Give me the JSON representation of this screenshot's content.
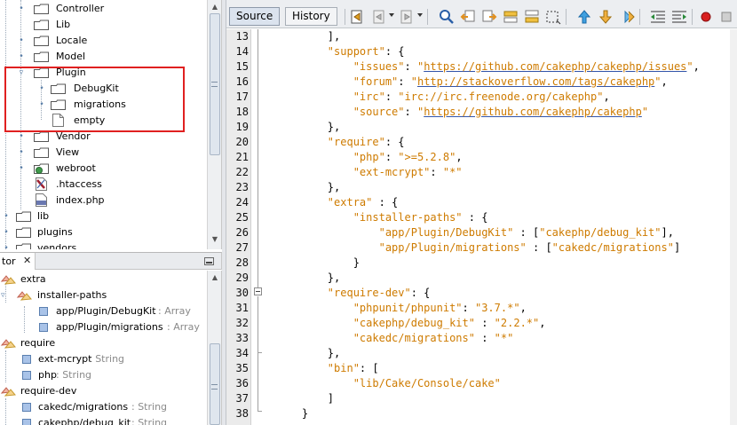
{
  "project_tree": {
    "items": [
      {
        "label": "Controller"
      },
      {
        "label": "Lib"
      },
      {
        "label": "Locale"
      },
      {
        "label": "Model"
      },
      {
        "label": "Plugin"
      },
      {
        "label": "DebugKit"
      },
      {
        "label": "migrations"
      },
      {
        "label": "empty"
      },
      {
        "label": "Vendor"
      },
      {
        "label": "View"
      },
      {
        "label": "webroot"
      },
      {
        "label": ".htaccess"
      },
      {
        "label": "index.php"
      },
      {
        "label": "lib"
      },
      {
        "label": "plugins"
      },
      {
        "label": "vendors"
      }
    ]
  },
  "navigator": {
    "tab_label": "tor",
    "close_glyph": "✕",
    "items": [
      {
        "label": "extra",
        "type": ""
      },
      {
        "label": "installer-paths",
        "type": ""
      },
      {
        "label": "app/Plugin/DebugKit",
        "type": " : Array"
      },
      {
        "label": "app/Plugin/migrations",
        "type": " : Array"
      },
      {
        "label": "require",
        "type": ""
      },
      {
        "label": "ext-mcrypt",
        "type": " : String"
      },
      {
        "label": "php",
        "type": " : String"
      },
      {
        "label": "require-dev",
        "type": ""
      },
      {
        "label": "cakedc/migrations",
        "type": " : String"
      },
      {
        "label": "cakephp/debug_kit",
        "type": " : String"
      }
    ]
  },
  "editor": {
    "tabs": {
      "source": "Source",
      "history": "History"
    },
    "colors": {
      "string": "#ce7b00",
      "link_underline": "#3355aa",
      "gutter": "#ebebeb"
    },
    "lines": [
      {
        "n": "13",
        "c": "        ],"
      },
      {
        "n": "14",
        "c": "        \"support\": {"
      },
      {
        "n": "15",
        "c": "            \"issues\": \"https://github.com/cakephp/cakephp/issues\","
      },
      {
        "n": "16",
        "c": "            \"forum\": \"http://stackoverflow.com/tags/cakephp\","
      },
      {
        "n": "17",
        "c": "            \"irc\": \"irc://irc.freenode.org/cakephp\","
      },
      {
        "n": "18",
        "c": "            \"source\": \"https://github.com/cakephp/cakephp\""
      },
      {
        "n": "19",
        "c": "        },"
      },
      {
        "n": "20",
        "c": "        \"require\": {"
      },
      {
        "n": "21",
        "c": "            \"php\": \">=5.2.8\","
      },
      {
        "n": "22",
        "c": "            \"ext-mcrypt\": \"*\""
      },
      {
        "n": "23",
        "c": "        },"
      },
      {
        "n": "24",
        "c": "        \"extra\" : {"
      },
      {
        "n": "25",
        "c": "            \"installer-paths\" : {"
      },
      {
        "n": "26",
        "c": "                \"app/Plugin/DebugKit\" : [\"cakephp/debug_kit\"],"
      },
      {
        "n": "27",
        "c": "                \"app/Plugin/migrations\" : [\"cakedc/migrations\"]"
      },
      {
        "n": "28",
        "c": "            }"
      },
      {
        "n": "29",
        "c": "        },"
      },
      {
        "n": "30",
        "c": "        \"require-dev\": {"
      },
      {
        "n": "31",
        "c": "            \"phpunit/phpunit\": \"3.7.*\","
      },
      {
        "n": "32",
        "c": "            \"cakephp/debug_kit\" : \"2.2.*\","
      },
      {
        "n": "33",
        "c": "            \"cakedc/migrations\" : \"*\""
      },
      {
        "n": "34",
        "c": "        },"
      },
      {
        "n": "35",
        "c": "        \"bin\": ["
      },
      {
        "n": "36",
        "c": "            \"lib/Cake/Console/cake\""
      },
      {
        "n": "37",
        "c": "        ]"
      },
      {
        "n": "38",
        "c": "    }"
      }
    ]
  }
}
